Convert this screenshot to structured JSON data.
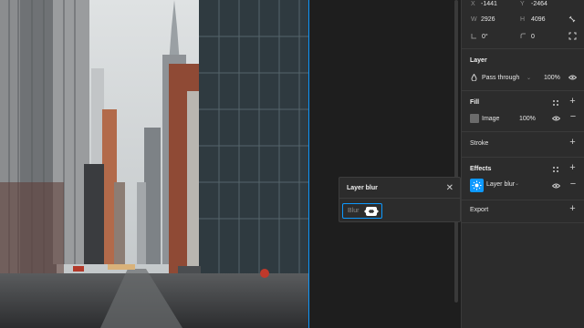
{
  "transform": {
    "x_label": "X",
    "x_value": "-1441",
    "y_label": "Y",
    "y_value": "-2464",
    "w_label": "W",
    "w_value": "2926",
    "h_label": "H",
    "h_value": "4096",
    "rotation_value": "0°",
    "radius_value": "0"
  },
  "layer": {
    "title": "Layer",
    "blend_mode": "Pass through",
    "opacity": "100%"
  },
  "fill": {
    "title": "Fill",
    "type": "Image",
    "opacity": "100%"
  },
  "stroke": {
    "title": "Stroke"
  },
  "effects": {
    "title": "Effects",
    "effect_name": "Layer blur"
  },
  "export": {
    "title": "Export"
  },
  "popover": {
    "title": "Layer blur",
    "field_placeholder": "Blur"
  },
  "colors": {
    "accent": "#0d99ff",
    "panel_bg": "#2c2c2c",
    "canvas_bg": "#1e1e1e"
  }
}
